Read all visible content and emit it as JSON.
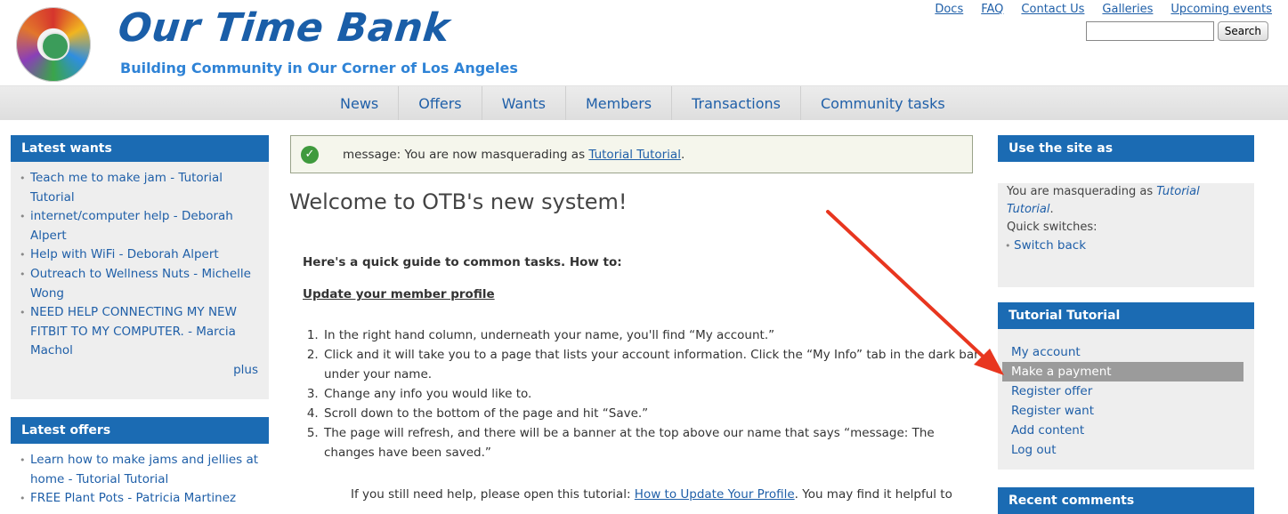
{
  "header": {
    "site_name": "Our Time Bank",
    "slogan": "Building Community in Our Corner of Los Angeles",
    "top_links": [
      "Docs",
      "FAQ",
      "Contact Us",
      "Galleries",
      "Upcoming events"
    ],
    "search": {
      "value": "",
      "button_label": "Search"
    }
  },
  "nav": [
    "News",
    "Offers",
    "Wants",
    "Members",
    "Transactions",
    "Community tasks"
  ],
  "left": {
    "wants": {
      "title": "Latest wants",
      "items": [
        "Teach me to make jam - Tutorial Tutorial",
        "internet/computer help - Deborah Alpert",
        "Help with WiFi - Deborah Alpert",
        "Outreach to Wellness Nuts - Michelle Wong",
        "NEED HELP CONNECTING MY NEW FITBIT TO MY COMPUTER. - Marcia Machol"
      ],
      "more_label": "plus"
    },
    "offers": {
      "title": "Latest offers",
      "items": [
        "Learn how to make jams and jellies at home - Tutorial Tutorial",
        "FREE Plant Pots - Patricia Martinez"
      ]
    }
  },
  "main": {
    "message_prefix": "message: You are now masquerading as ",
    "message_link": "Tutorial Tutorial",
    "message_suffix": ".",
    "title": "Welcome to OTB's new system!",
    "intro": "Here's a quick guide to common tasks. How to:",
    "section_link": "Update your member profile",
    "steps": [
      "In the right hand column, underneath your name, you'll find “My account.”",
      "Click and it will take you to a page that lists your account information. Click the “My Info” tab in the dark bar under your name.",
      "Change any info you would like to.",
      "Scroll down to the bottom of the page and hit “Save.”",
      "The page will refresh, and there will be a banner at the top above our name that says “message: The changes have been saved.”"
    ],
    "help_prefix": "If you still need help, please open this tutorial: ",
    "help_link": "How to Update Your Profile",
    "help_suffix": ". You may find it helpful to"
  },
  "right": {
    "use_as": {
      "title": "Use the site as",
      "masq_prefix": "You are masquerading as ",
      "masq_name": "Tutorial Tutorial",
      "masq_suffix": ".",
      "quick_switches": "Quick switches:",
      "switch_back": "Switch back"
    },
    "user": {
      "title": "Tutorial Tutorial",
      "menu": [
        "My account",
        "Make a payment",
        "Register offer",
        "Register want",
        "Add content",
        "Log out"
      ]
    },
    "recent": {
      "title": "Recent comments"
    }
  },
  "colors": {
    "brand_blue": "#1b6bb3",
    "link_blue": "#1f5fa8",
    "arrow_red": "#e8361f",
    "success_green": "#3f9a3d"
  },
  "icons": {
    "message": "check-circle-icon",
    "annotation": "red-arrow"
  }
}
